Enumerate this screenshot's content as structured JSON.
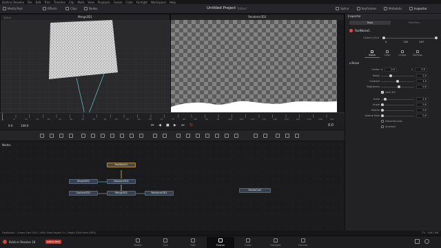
{
  "app": {
    "name": "DaVinci Resolve"
  },
  "menu": [
    "DaVinci Resolve",
    "File",
    "Edit",
    "Trim",
    "Timeline",
    "Clip",
    "Mark",
    "View",
    "Playback",
    "Fusion",
    "Color",
    "Fairlight",
    "Workspace",
    "Help"
  ],
  "toolbar": {
    "left": [
      "Media Pool",
      "Effects",
      "Clips",
      "Nodes"
    ],
    "project_title": "Untitled Project",
    "project_state": "Edited",
    "right": [
      "Spline",
      "Keyframes",
      "Metadata",
      "Inspector"
    ]
  },
  "viewer_left": {
    "title": "Merge3D1",
    "zoom": "12% ▾"
  },
  "viewer_right": {
    "title": "Renderer3D1"
  },
  "ruler": {
    "ticks": [
      "0",
      "5",
      "10",
      "15",
      "20",
      "25",
      "30",
      "35",
      "40",
      "45",
      "50",
      "55",
      "60",
      "65",
      "70",
      "75",
      "80",
      "85",
      "90",
      "95",
      "100",
      "105",
      "110",
      "115",
      "120",
      "125",
      "130",
      "135",
      "140",
      "145"
    ]
  },
  "transport": {
    "start": "0.0",
    "end": "149.0",
    "current": "0.0"
  },
  "nodes_panel": {
    "title": "Nodes"
  },
  "nodes": {
    "fastnoise": "FastNoise1",
    "shape": "Shape3D1",
    "displace": "Displace3D1",
    "camera": "Camera3D1",
    "merge": "Merge3D1",
    "renderer": "Renderer3D1",
    "mediaout": "MediaOut1"
  },
  "inspector": {
    "title": "Inspector",
    "tabs": [
      "Tools",
      "Modifiers"
    ],
    "node_name": "FastNoise1",
    "global_label": "Global In/Out",
    "global_values": [
      "0",
      "118",
      "149"
    ],
    "subtabs": [
      "Noise",
      "Color",
      "Image",
      "Settings"
    ],
    "section": "Noise",
    "params": [
      {
        "label": "Center",
        "x": "0.5",
        "y": "0.5"
      },
      {
        "label": "Detail",
        "value": "2.0"
      },
      {
        "label": "Contrast",
        "value": "1.0"
      },
      {
        "label": "Brightness",
        "value": "0.0"
      }
    ],
    "lock_xy": "Lock X/Y",
    "params2": [
      {
        "label": "Scale",
        "value": "2.0"
      },
      {
        "label": "Angle",
        "value": "0.0"
      },
      {
        "label": "Seethe",
        "value": "0.0"
      },
      {
        "label": "Seethe Rate",
        "value": "0.0"
      }
    ],
    "discontinuous": "Discontinuous",
    "inverted": "Inverted"
  },
  "status": {
    "left": "FastNoise1 - Frame Size 1920, 1080, Pixel Aspect 1:1, Depth 32bit float (GPU)",
    "right": "7% · 4061 MB"
  },
  "pages": [
    {
      "label": "Media"
    },
    {
      "label": "Cut"
    },
    {
      "label": "Edit"
    },
    {
      "label": "Fusion",
      "active": true
    },
    {
      "label": "Color"
    },
    {
      "label": "Fairlight"
    },
    {
      "label": "Deliver"
    }
  ],
  "branding": {
    "name": "DaVinci Resolve 18",
    "badge": "PUBLIC BETA"
  },
  "colors": {
    "accent": "#e64b3b",
    "node": "#36404f",
    "selected_outline": "#b08a3a"
  }
}
